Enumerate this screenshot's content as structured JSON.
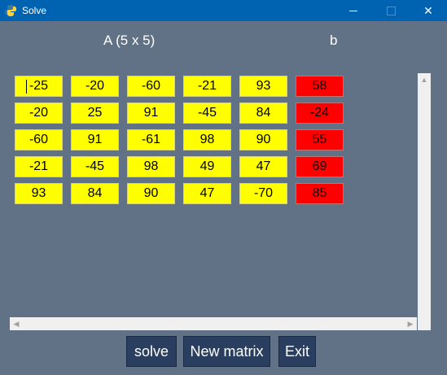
{
  "window": {
    "title": "Solve",
    "icon": "python-icon",
    "controls": {
      "minimize": "—",
      "maximize": "☐",
      "close": "✕"
    }
  },
  "headers": {
    "matrix": "A (5 x 5)",
    "vector": "b"
  },
  "matrix_A": [
    [
      "-25",
      "-20",
      "-60",
      "-21",
      "93"
    ],
    [
      "-20",
      "25",
      "91",
      "-45",
      "84"
    ],
    [
      "-60",
      "91",
      "-61",
      "98",
      "90"
    ],
    [
      "-21",
      "-45",
      "98",
      "49",
      "47"
    ],
    [
      "93",
      "84",
      "90",
      "47",
      "-70"
    ]
  ],
  "vector_b": [
    "58",
    "-24",
    "55",
    "69",
    "85"
  ],
  "buttons": {
    "solve": "solve",
    "new_matrix": "New matrix",
    "exit": "Exit"
  },
  "colors": {
    "a_cell": "#ffff00",
    "b_cell": "#ff0000",
    "background": "#617286",
    "button": "#2a3f5f"
  }
}
